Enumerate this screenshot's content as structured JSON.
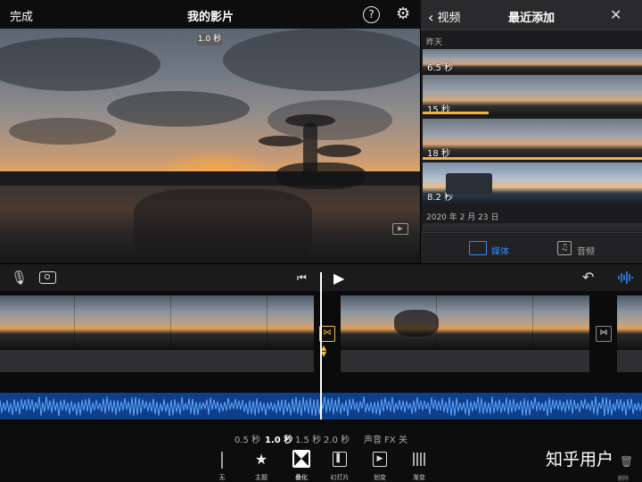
{
  "header": {
    "done_label": "完成",
    "title": "我的影片",
    "help_icon": "question-icon",
    "settings_icon": "gear-icon"
  },
  "viewer": {
    "duration_badge": "1.0 秒"
  },
  "media_panel": {
    "back_label": "视频",
    "title": "最近添加",
    "close_icon": "close-icon",
    "section_yesterday": "昨天",
    "clips": [
      {
        "label": "6.5 秒"
      },
      {
        "label": "15 秒"
      },
      {
        "label": "18 秒"
      },
      {
        "label": "8.2 秒"
      }
    ],
    "section_date": "2020 年 2 月 23 日",
    "tabs": [
      {
        "label": "媒体",
        "active": true
      },
      {
        "label": "音频",
        "active": false
      }
    ]
  },
  "timeline_toolbar": {
    "mic_icon": "microphone-icon",
    "camera_icon": "camera-icon",
    "skip_icon": "skip-back-icon",
    "play_icon": "play-icon",
    "undo_icon": "undo-icon",
    "wave_icon": "audio-wave-icon"
  },
  "transition_options": {
    "durations": [
      "0.5 秒",
      "1.0 秒",
      "1.5 秒",
      "2.0 秒"
    ],
    "selected_duration": "1.0 秒",
    "sound_fx": "声音 FX 关",
    "tools": [
      {
        "label": "无",
        "icon": "none-transition-icon"
      },
      {
        "label": "主题",
        "icon": "star-icon"
      },
      {
        "label": "叠化",
        "icon": "dissolve-icon"
      },
      {
        "label": "幻灯片",
        "icon": "slide-icon"
      },
      {
        "label": "划变",
        "icon": "wipe-icon"
      },
      {
        "label": "渐变",
        "icon": "fade-icon"
      }
    ]
  },
  "delete_label": "删除",
  "watermark": "知乎用户",
  "colors": {
    "accent_blue": "#2f8cff",
    "transition_yellow": "#f0c23a",
    "audio_track": "#0f3f88"
  }
}
